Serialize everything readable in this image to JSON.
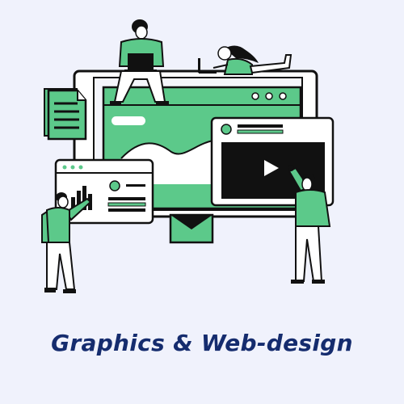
{
  "caption": "Graphics & Web-design",
  "colors": {
    "background": "#f0f2fc",
    "accent": "#5cc98a",
    "ink": "#111111",
    "caption": "#152c6e",
    "panel": "#ffffff"
  },
  "icons": [
    "document-icon",
    "play-icon",
    "envelope-icon",
    "bar-chart-icon",
    "laptop-icon"
  ]
}
